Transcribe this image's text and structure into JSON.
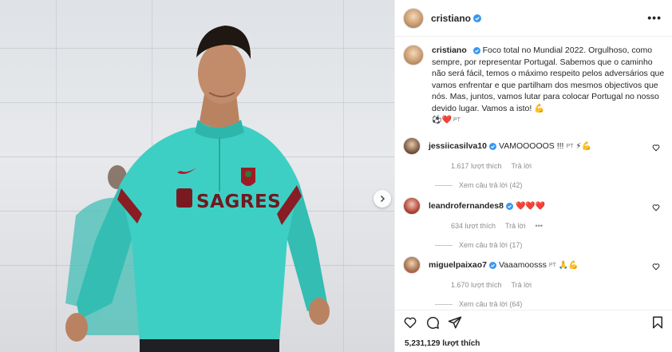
{
  "post": {
    "author": "cristiano",
    "more_label": "•••",
    "caption_author": "cristiano",
    "caption_text": "Foco total no Mundial 2022. Orgulhoso, como sempre, por representar Portugal. Sabemos que o caminho não será fácil, temos o máximo respeito pelos adversários que vamos enfrentar e que partilham dos mesmos objectivos que nós. Mas, juntos, vamos lutar para colocar Portugal no nosso devido lugar. Vamos a isto! 💪",
    "caption_footer_flag": "PT",
    "caption_footer_emoji": "⚽❤️",
    "likes": "5,231,129 lượt thích"
  },
  "photo": {
    "shirt_sponsor": "SAGRES",
    "accent": "#3ecfc4"
  },
  "comments": [
    {
      "username": "jessiicasilva10",
      "text": "VAMOOOOOS !!!",
      "flag": "PT",
      "emoji": "⚡💪",
      "likes": "1.617 lượt thích",
      "reply": "Trả lời",
      "view_replies": "Xem câu trả lời (42)"
    },
    {
      "username": "leandrofernandes8",
      "text": "",
      "flag": "",
      "emoji": "❤️❤️❤️",
      "likes": "634 lượt thích",
      "reply": "Trả lời",
      "more": "•••",
      "view_replies": "Xem câu trả lời (17)"
    },
    {
      "username": "miguelpaixao7",
      "text": "Vaaamoosss",
      "flag": "PT",
      "emoji": "🙏💪",
      "likes": "1.670 lượt thích",
      "reply": "Trả lời",
      "view_replies": "Xem câu trả lời (64)"
    }
  ],
  "icons": {
    "like": "heart-icon",
    "comment": "comment-icon",
    "share": "share-icon",
    "save": "bookmark-icon",
    "verified": "verified-badge-icon",
    "next": "chevron-right-icon"
  },
  "colors": {
    "verified": "#3897f0",
    "heart": "#ed4956",
    "muted": "#8e8e8e"
  }
}
